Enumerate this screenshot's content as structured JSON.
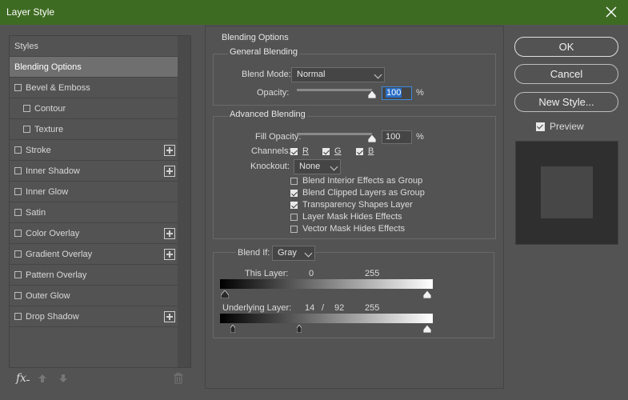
{
  "window": {
    "title": "Layer Style"
  },
  "styles_panel": {
    "items": [
      {
        "label": "Styles",
        "checkbox": false,
        "selected": false,
        "indent": 0,
        "plus": false
      },
      {
        "label": "Blending Options",
        "checkbox": false,
        "selected": true,
        "indent": 0,
        "plus": false
      },
      {
        "label": "Bevel & Emboss",
        "checkbox": true,
        "checked": false,
        "indent": 0,
        "plus": false
      },
      {
        "label": "Contour",
        "checkbox": true,
        "checked": false,
        "indent": 1,
        "plus": false
      },
      {
        "label": "Texture",
        "checkbox": true,
        "checked": false,
        "indent": 1,
        "plus": false
      },
      {
        "label": "Stroke",
        "checkbox": true,
        "checked": false,
        "indent": 0,
        "plus": true
      },
      {
        "label": "Inner Shadow",
        "checkbox": true,
        "checked": false,
        "indent": 0,
        "plus": true
      },
      {
        "label": "Inner Glow",
        "checkbox": true,
        "checked": false,
        "indent": 0,
        "plus": false
      },
      {
        "label": "Satin",
        "checkbox": true,
        "checked": false,
        "indent": 0,
        "plus": false
      },
      {
        "label": "Color Overlay",
        "checkbox": true,
        "checked": false,
        "indent": 0,
        "plus": true
      },
      {
        "label": "Gradient Overlay",
        "checkbox": true,
        "checked": false,
        "indent": 0,
        "plus": true
      },
      {
        "label": "Pattern Overlay",
        "checkbox": true,
        "checked": false,
        "indent": 0,
        "plus": false
      },
      {
        "label": "Outer Glow",
        "checkbox": true,
        "checked": false,
        "indent": 0,
        "plus": false
      },
      {
        "label": "Drop Shadow",
        "checkbox": true,
        "checked": false,
        "indent": 0,
        "plus": true
      }
    ],
    "footer": {
      "fx_label": "fx"
    }
  },
  "blending_options": {
    "title": "Blending Options",
    "general": {
      "title": "General Blending",
      "blend_mode_label": "Blend Mode:",
      "blend_mode_value": "Normal",
      "opacity_label": "Opacity:",
      "opacity_value": "100",
      "opacity_percent": 100,
      "unit": "%"
    },
    "advanced": {
      "title": "Advanced Blending",
      "fill_opacity_label": "Fill Opacity:",
      "fill_opacity_value": "100",
      "fill_opacity_percent": 100,
      "unit": "%",
      "channels_label": "Channels:",
      "channels": [
        {
          "label": "R",
          "checked": true
        },
        {
          "label": "G",
          "checked": true
        },
        {
          "label": "B",
          "checked": true
        }
      ],
      "knockout_label": "Knockout:",
      "knockout_value": "None",
      "options": [
        {
          "label": "Blend Interior Effects as Group",
          "checked": false
        },
        {
          "label": "Blend Clipped Layers as Group",
          "checked": true
        },
        {
          "label": "Transparency Shapes Layer",
          "checked": true
        },
        {
          "label": "Layer Mask Hides Effects",
          "checked": false
        },
        {
          "label": "Vector Mask Hides Effects",
          "checked": false
        }
      ]
    },
    "blend_if": {
      "label": "Blend If:",
      "value": "Gray",
      "this_layer_label": "This Layer:",
      "this_layer_low": "0",
      "this_layer_high": "255",
      "underlying_label": "Underlying Layer:",
      "underlying_low": "14",
      "underlying_sep": "/",
      "underlying_mid": "92",
      "underlying_high": "255"
    }
  },
  "buttons": {
    "ok": "OK",
    "cancel": "Cancel",
    "new_style": "New Style...",
    "preview_label": "Preview",
    "preview_checked": true
  },
  "colors": {
    "titlebar": "#3e6b22",
    "background": "#535353",
    "selected": "#6f6f6f"
  }
}
